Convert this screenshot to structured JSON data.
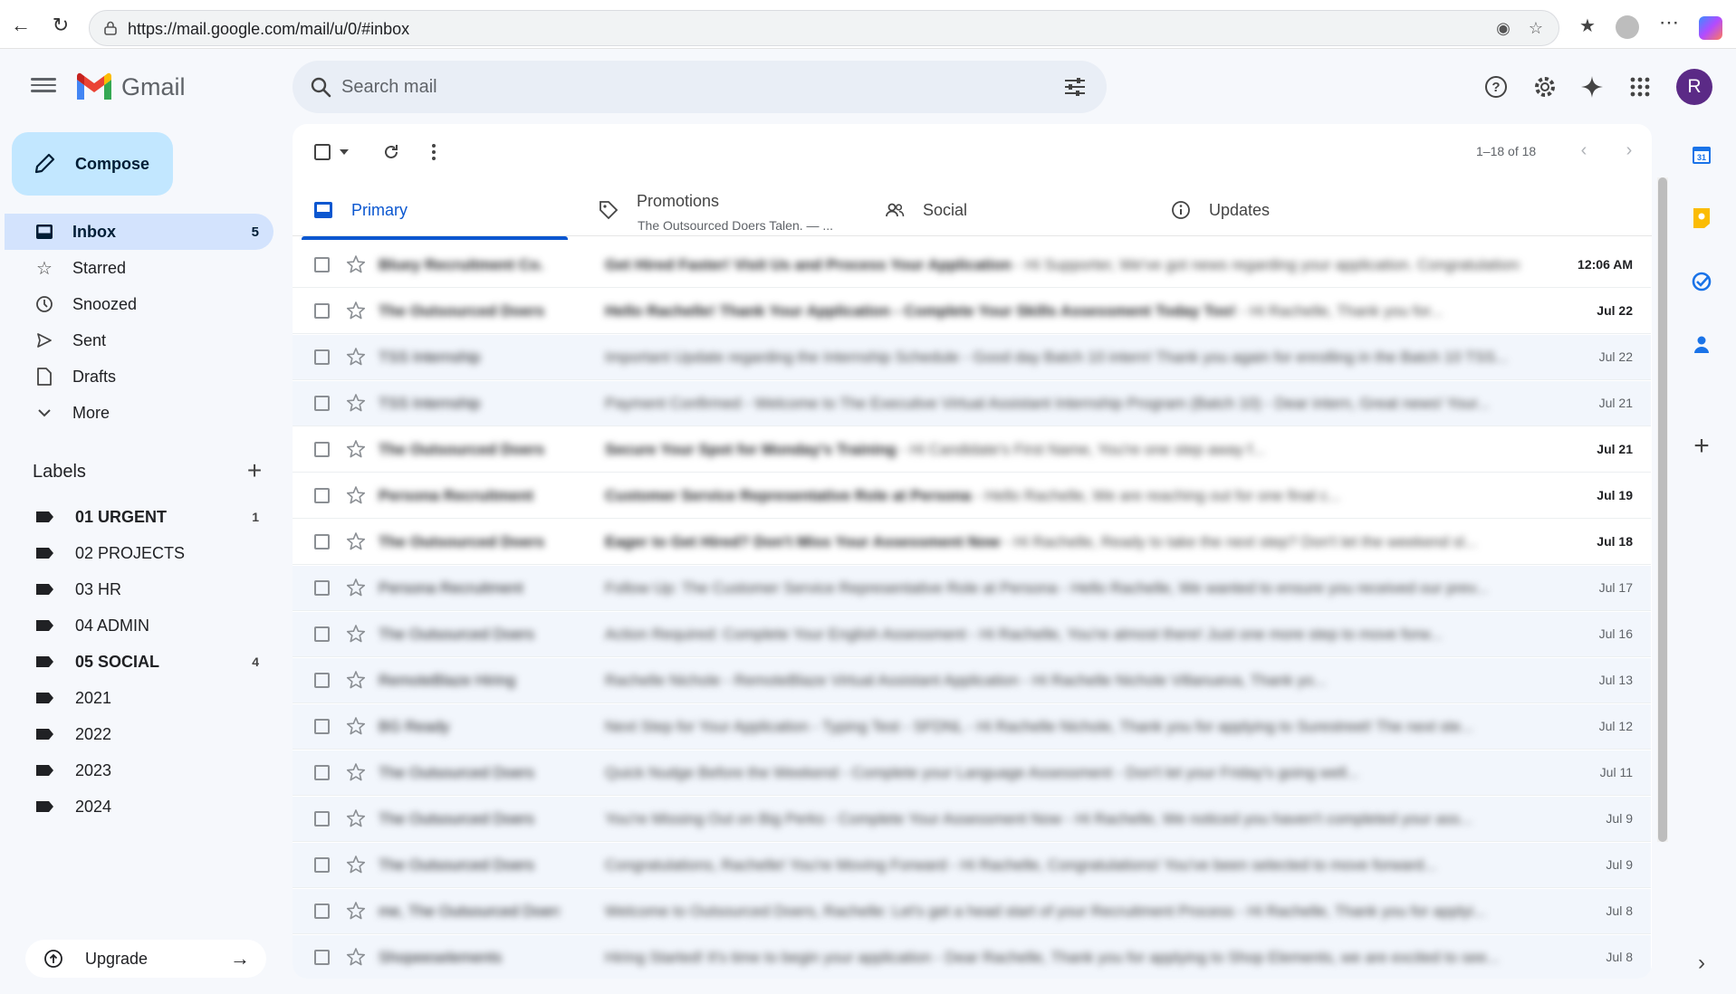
{
  "browser": {
    "url": "https://mail.google.com/mail/u/0/#inbox"
  },
  "gmail": {
    "brand": "Gmail",
    "search_placeholder": "Search mail",
    "avatar_letter": "R"
  },
  "compose_label": "Compose",
  "nav": [
    {
      "label": "Inbox",
      "count": "5",
      "icon": "inbox-icon",
      "active": true
    },
    {
      "label": "Starred",
      "count": "",
      "icon": "star-icon"
    },
    {
      "label": "Snoozed",
      "count": "",
      "icon": "clock-icon"
    },
    {
      "label": "Sent",
      "count": "",
      "icon": "send-icon"
    },
    {
      "label": "Drafts",
      "count": "",
      "icon": "draft-icon"
    },
    {
      "label": "More",
      "count": "",
      "icon": "chevron-down-icon"
    }
  ],
  "labels_title": "Labels",
  "labels": [
    {
      "name": "01 URGENT",
      "count": "1",
      "bold": true
    },
    {
      "name": "02 PROJECTS",
      "count": ""
    },
    {
      "name": "03 HR",
      "count": ""
    },
    {
      "name": "04 ADMIN",
      "count": ""
    },
    {
      "name": "05 SOCIAL",
      "count": "4",
      "bold": true
    },
    {
      "name": "2021",
      "count": ""
    },
    {
      "name": "2022",
      "count": ""
    },
    {
      "name": "2023",
      "count": ""
    },
    {
      "name": "2024",
      "count": ""
    }
  ],
  "upgrade_label": "Upgrade",
  "pager": "1–18 of 18",
  "tabs": {
    "primary": "Primary",
    "promotions": "Promotions",
    "promotions_sub": "The Outsourced Doers Talen. — ...",
    "social": "Social",
    "updates": "Updates"
  },
  "emails": [
    {
      "sender": "Bluey Recruitment Co.",
      "subject": "Get Hired Faster! Visit Us and Process Your Application",
      "snippet": "Hi Supporter, We've got news regarding your application. Congratulations",
      "date": "12:06 AM",
      "unread": true
    },
    {
      "sender": "The Outsourced Doers",
      "subject": "Hello Rachelle! Thank Your Application - Complete Your Skills Assessment Today Too!",
      "snippet": "Hi Rachelle, Thank you for...",
      "date": "Jul 22",
      "unread": true
    },
    {
      "sender": "TSS Internship",
      "subject": "Important Update regarding the Internship Schedule",
      "snippet": "Good day Batch 10 intern! Thank you again for enrolling in the Batch 10 TSS...",
      "date": "Jul 22",
      "unread": false
    },
    {
      "sender": "TSS Internship",
      "subject": "Payment Confirmed - Welcome to The Executive Virtual Assistant Internship Program (Batch 10)",
      "snippet": "Dear intern, Great news! Your...",
      "date": "Jul 21",
      "unread": false
    },
    {
      "sender": "The Outsourced Doers",
      "subject": "Secure Your Spot for Monday's Training",
      "snippet": "Hi Candidate's First Name, You're one step away f...",
      "date": "Jul 21",
      "unread": true
    },
    {
      "sender": "Persona Recruitment",
      "subject": "Customer Service Representative Role at Persona",
      "snippet": "Hello Rachelle, We are reaching out for one final c...",
      "date": "Jul 19",
      "unread": true
    },
    {
      "sender": "The Outsourced Doers",
      "subject": "Eager to Get Hired? Don't Miss Your Assessment Now",
      "snippet": "Hi Rachelle, Ready to take the next step? Don't let the weekend sl...",
      "date": "Jul 18",
      "unread": true
    },
    {
      "sender": "Persona Recruitment",
      "subject": "Follow Up: The Customer Service Representative Role at Persona",
      "snippet": "Hello Rachelle, We wanted to ensure you received our prev...",
      "date": "Jul 17",
      "unread": false
    },
    {
      "sender": "The Outsourced Doers",
      "subject": "Action Required: Complete Your English Assessment",
      "snippet": "Hi Rachelle, You're almost there! Just one more step to move forw...",
      "date": "Jul 16",
      "unread": false
    },
    {
      "sender": "RemoteBlaze Hiring",
      "subject": "Rachelle Nichole - RemoteBlaze Virtual Assistant Application",
      "snippet": "Hi Rachelle Nichole Villanueva, Thank yo...",
      "date": "Jul 13",
      "unread": false
    },
    {
      "sender": "BG Ready",
      "subject": "Next Step for Your Application - Typing Test - SFDNL",
      "snippet": "Hi Rachelle Nichole, Thank you for applying to Surestreet! The next ste...",
      "date": "Jul 12",
      "unread": false
    },
    {
      "sender": "The Outsourced Doers",
      "subject": "Quick Nudge Before the Weekend - Complete your Language Assessment",
      "snippet": "Don't let your Friday's going well...",
      "date": "Jul 11",
      "unread": false
    },
    {
      "sender": "The Outsourced Doers",
      "subject": "You're Missing Out on Big Perks - Complete Your Assessment Now",
      "snippet": "Hi Rachelle, We noticed you haven't completed your ass...",
      "date": "Jul 9",
      "unread": false
    },
    {
      "sender": "The Outsourced Doers",
      "subject": "Congratulations, Rachelle! You're Moving Forward",
      "snippet": "Hi Rachelle, Congratulations! You've been selected to move forward...",
      "date": "Jul 9",
      "unread": false
    },
    {
      "sender": "me, The Outsourced Doers",
      "subject": "Welcome to Outsourced Doers, Rachelle: Let's get a head start of your Recruitment Process",
      "snippet": "Hi Rachelle, Thank you for applyi...",
      "date": "Jul 8",
      "unread": false
    },
    {
      "sender": "Shopeeselements",
      "subject": "Hiring Started! It's time to begin your application",
      "snippet": "Dear Rachelle, Thank you for applying to Shop Elements, we are excited to see...",
      "date": "Jul 8",
      "unread": false
    }
  ],
  "colors": {
    "primary_blue": "#0b57d0",
    "compose_bg": "#c2e7ff",
    "active_nav_bg": "#d3e3fd",
    "avatar_bg": "#5b2a86"
  }
}
